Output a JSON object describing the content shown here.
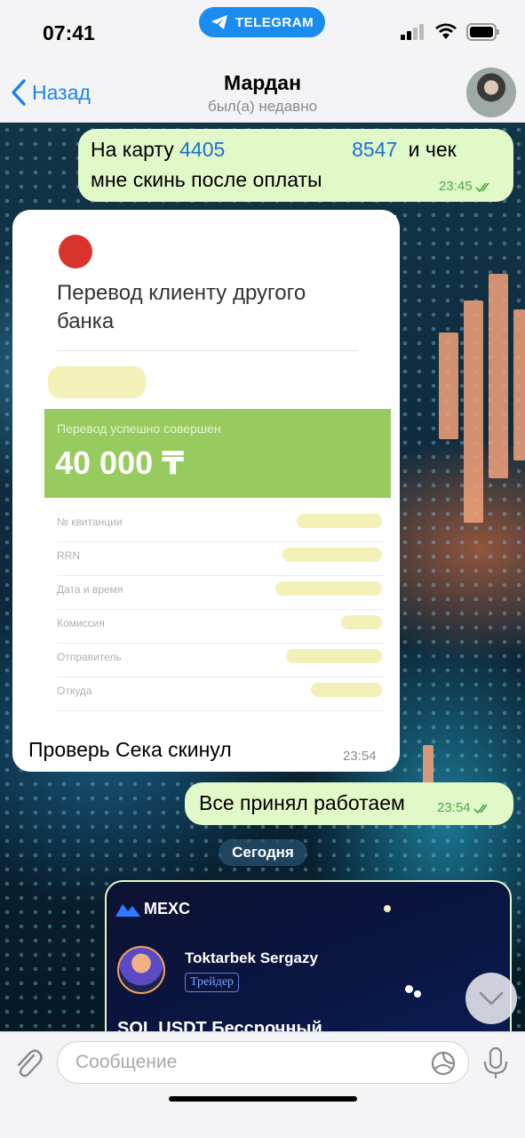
{
  "status_bar": {
    "time": "07:41",
    "pill_label": "TELEGRAM"
  },
  "header": {
    "back_label": "Назад",
    "title": "Мардан",
    "subtitle": "был(а) недавно"
  },
  "messages": {
    "m1": {
      "prefix": "На карту",
      "num1": "4405",
      "num2": "8547",
      "suffix": "и чек",
      "line2": "мне скинь после оплаты",
      "time": "23:45"
    },
    "m2": {
      "receipt": {
        "title": "Перевод клиенту другого банка",
        "status_label": "Перевод успешно совершен",
        "amount": "40 000 ₸",
        "rows": [
          "№ квитанции",
          "RRN",
          "Дата и время",
          "Комиссия",
          "Отправитель",
          "Откуда"
        ]
      },
      "caption": "Проверь Сека скинул",
      "time": "23:54"
    },
    "m3": {
      "text": "Все принял работаем",
      "time": "23:54"
    }
  },
  "date_divider": "Сегодня",
  "mexc_card": {
    "brand": "MEXC",
    "trader_name": "Toktarbek Sergazy",
    "badge": "Трейдер",
    "pair_title": "SOL USDT Бессрочный"
  },
  "composer": {
    "placeholder": "Сообщение"
  },
  "colors": {
    "accent": "#1a84ea",
    "outgoing_bubble": "#e1f8c8",
    "receipt_green": "#97cb60"
  }
}
